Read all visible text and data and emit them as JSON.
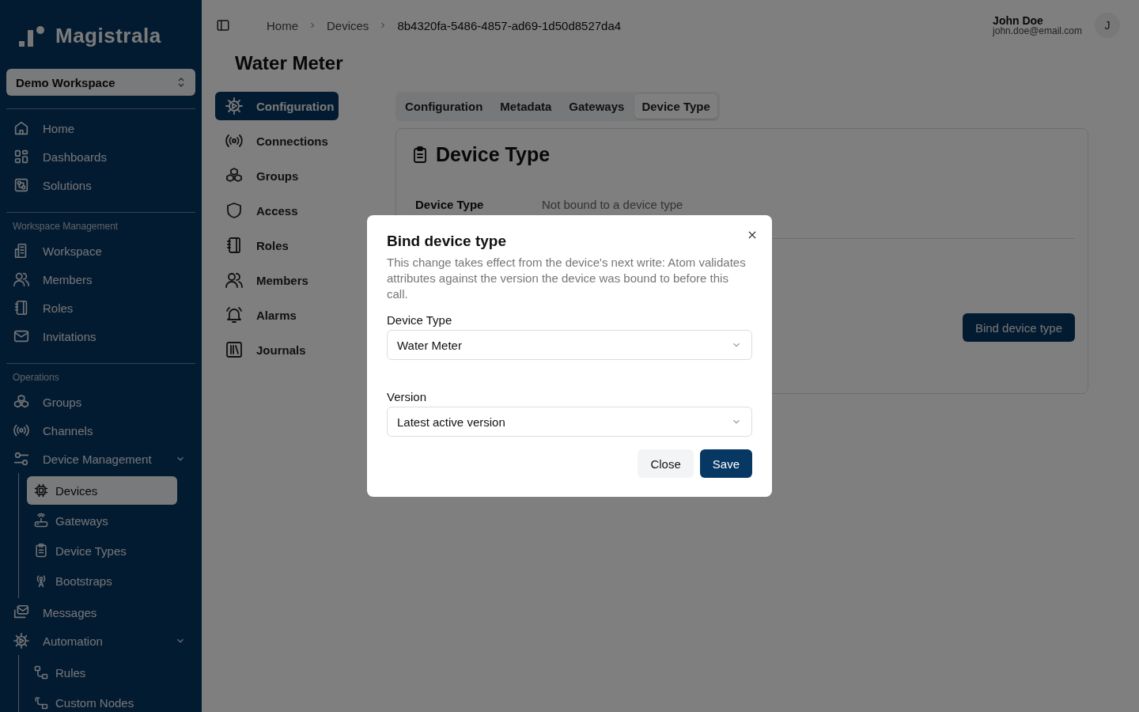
{
  "sidebar": {
    "logo": "Magistrala",
    "workspace_select": "Demo Workspace",
    "sections": [
      {
        "items": [
          {
            "label": "Home",
            "selected": false
          },
          {
            "label": "Dashboards",
            "selected": false
          },
          {
            "label": "Solutions",
            "selected": false
          }
        ]
      },
      {
        "title": "Workspace Management",
        "items": [
          {
            "label": "Workspace",
            "selected": false
          },
          {
            "label": "Members",
            "selected": false
          },
          {
            "label": "Roles",
            "selected": false
          },
          {
            "label": "Invitations",
            "selected": false
          }
        ]
      },
      {
        "title": "Operations",
        "items": [
          {
            "label": "Groups",
            "selected": false
          },
          {
            "label": "Channels",
            "selected": false
          },
          {
            "label": "Device Management",
            "selected": false,
            "expanded": true,
            "children": [
              {
                "label": "Devices",
                "selected": true
              },
              {
                "label": "Gateways",
                "selected": false
              },
              {
                "label": "Device Types",
                "selected": false
              },
              {
                "label": "Bootstraps",
                "selected": false
              }
            ]
          },
          {
            "label": "Messages",
            "selected": false
          },
          {
            "label": "Automation",
            "selected": false,
            "expanded": true,
            "children": [
              {
                "label": "Rules",
                "selected": false
              },
              {
                "label": "Custom Nodes",
                "selected": false
              }
            ]
          }
        ]
      }
    ]
  },
  "breadcrumb": [
    "Home",
    "Devices",
    "8b4320fa-5486-4857-ad69-1d50d8527da4"
  ],
  "user": {
    "name": "John Doe",
    "email": "john.doe@email.com",
    "initial": "J"
  },
  "page_title": "Water Meter",
  "side_nav": [
    {
      "label": "Configuration",
      "selected": true
    },
    {
      "label": "Connections",
      "selected": false
    },
    {
      "label": "Groups",
      "selected": false
    },
    {
      "label": "Access",
      "selected": false
    },
    {
      "label": "Roles",
      "selected": false
    },
    {
      "label": "Members",
      "selected": false
    },
    {
      "label": "Alarms",
      "selected": false
    },
    {
      "label": "Journals",
      "selected": false
    }
  ],
  "tabs": [
    {
      "label": "Configuration",
      "selected": false
    },
    {
      "label": "Metadata",
      "selected": false
    },
    {
      "label": "Gateways",
      "selected": false
    },
    {
      "label": "Device Type",
      "selected": true
    }
  ],
  "card": {
    "title": "Device Type",
    "field_label": "Device Type",
    "field_value": "Not bound to a device type",
    "button": "Bind device type"
  },
  "dialog": {
    "title": "Bind device type",
    "description": "This change takes effect from the device's next write: Atom validates attributes against the version the device was bound to before this call.",
    "fields": [
      {
        "label": "Device Type",
        "value": "Water Meter"
      },
      {
        "label": "Version",
        "value": "Latest active version"
      }
    ],
    "buttons": [
      {
        "label": "Close",
        "kind": "secondary"
      },
      {
        "label": "Save",
        "kind": "primary"
      }
    ]
  }
}
